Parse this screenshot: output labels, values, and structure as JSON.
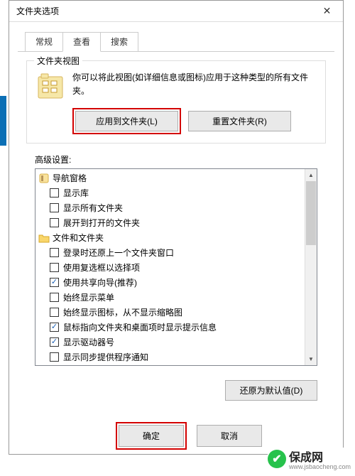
{
  "title": "文件夹选项",
  "tabs": [
    "常规",
    "查看",
    "搜索"
  ],
  "activeTab": 1,
  "folderViews": {
    "groupLabel": "文件夹视图",
    "desc": "你可以将此视图(如详细信息或图标)应用于这种类型的所有文件夹。",
    "applyBtn": "应用到文件夹(L)",
    "resetBtn": "重置文件夹(R)"
  },
  "advancedLabel": "高级设置:",
  "tree": [
    {
      "type": "group",
      "icon": "nav",
      "label": "导航窗格"
    },
    {
      "type": "check",
      "checked": false,
      "label": "显示库"
    },
    {
      "type": "check",
      "checked": false,
      "label": "显示所有文件夹"
    },
    {
      "type": "check",
      "checked": false,
      "label": "展开到打开的文件夹"
    },
    {
      "type": "group",
      "icon": "folder",
      "label": "文件和文件夹"
    },
    {
      "type": "check",
      "checked": false,
      "label": "登录时还原上一个文件夹窗口"
    },
    {
      "type": "check",
      "checked": false,
      "label": "使用复选框以选择项"
    },
    {
      "type": "check",
      "checked": true,
      "label": "使用共享向导(推荐)"
    },
    {
      "type": "check",
      "checked": false,
      "label": "始终显示菜单"
    },
    {
      "type": "check",
      "checked": false,
      "label": "始终显示图标，从不显示缩略图"
    },
    {
      "type": "check",
      "checked": true,
      "label": "鼠标指向文件夹和桌面项时显示提示信息"
    },
    {
      "type": "check",
      "checked": true,
      "label": "显示驱动器号"
    },
    {
      "type": "check",
      "checked": false,
      "label": "显示同步提供程序通知"
    }
  ],
  "restoreBtn": "还原为默认值(D)",
  "footer": {
    "ok": "确定",
    "cancel": "取消"
  },
  "watermark": {
    "name": "保成网",
    "sub": "www.jsbaocheng.com"
  }
}
